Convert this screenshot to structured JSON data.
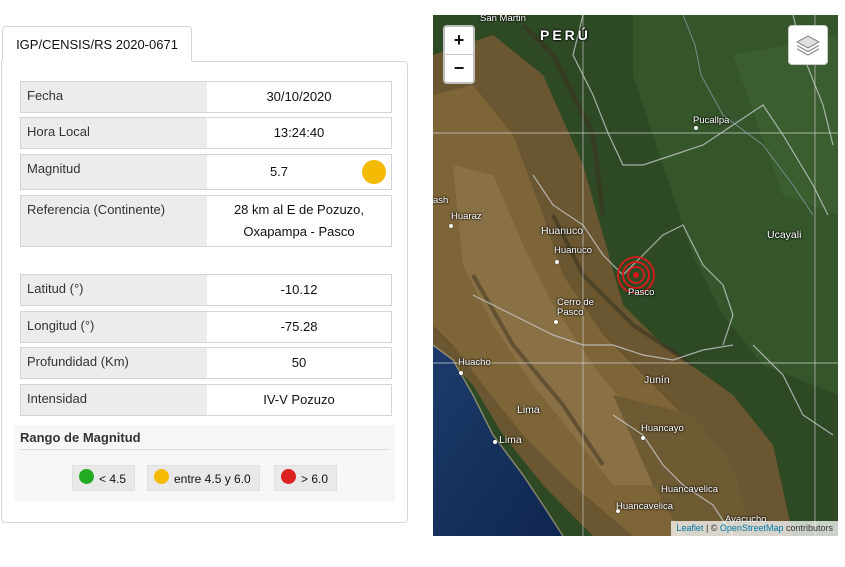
{
  "tab": {
    "label": "IGP/CENSIS/RS 2020-0671"
  },
  "details": {
    "fecha": {
      "label": "Fecha",
      "value": "30/10/2020"
    },
    "hora": {
      "label": "Hora Local",
      "value": "13:24:40"
    },
    "magnitud": {
      "label": "Magnitud",
      "value": "5.7",
      "indicator_color": "#f5bb00"
    },
    "referencia": {
      "label": "Referencia (Continente)",
      "value_line1": "28 km al E de Pozuzo,",
      "value_line2": "Oxapampa - Pasco"
    },
    "latitud": {
      "label": "Latitud (°)",
      "value": "-10.12"
    },
    "longitud": {
      "label": "Longitud (°)",
      "value": "-75.28"
    },
    "profundidad": {
      "label": "Profundidad (Km)",
      "value": "50"
    },
    "intensidad": {
      "label": "Intensidad",
      "value": "IV-V Pozuzo"
    }
  },
  "legend": {
    "title": "Rango de Magnitud",
    "items": [
      {
        "label": "< 4.5",
        "color": "#22aa22"
      },
      {
        "label": "entre 4.5 y 6.0",
        "color": "#f5bb00"
      },
      {
        "label": "> 6.0",
        "color": "#dd2222"
      }
    ]
  },
  "map": {
    "zoom_in": "+",
    "zoom_out": "−",
    "layers_icon": "layers-icon",
    "epicenter_color": "#d91a1a",
    "places": {
      "country": "PERÚ",
      "san_martin": "San Martin",
      "pucallpa": "Pucallpa",
      "ucayali": "Ucayali",
      "ash": "ash",
      "huaraz": "Huaraz",
      "huanuco_region": "Huanuco",
      "huanuco_city": "Huanuco",
      "pasco": "Pasco",
      "cerro_de_pasco_1": "Cerro de",
      "cerro_de_pasco_2": "Pasco",
      "huacho": "Huacho",
      "lima_region": "Lima",
      "lima_city": "Lima",
      "junin": "Junín",
      "huancayo": "Huancayo",
      "huancavelica_region": "Huancavelica",
      "huancavelica_city": "Huancavelica",
      "ayacucho": "Ayacucho"
    },
    "attribution": {
      "leaflet": "Leaflet",
      "separator": " | © ",
      "osm": "OpenStreetMap",
      "suffix": " contributors"
    }
  }
}
